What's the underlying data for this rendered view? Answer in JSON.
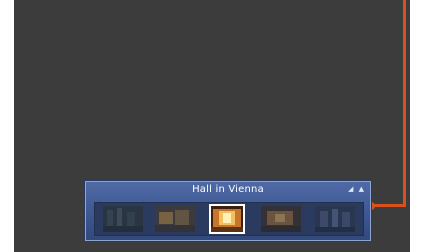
{
  "panel": {
    "title": "Hall in Vienna",
    "controls": [
      "resize-icon",
      "collapse-icon"
    ]
  },
  "thumbnails": [
    {
      "name": "dark-hall",
      "selected": false
    },
    {
      "name": "warm-hall",
      "selected": false
    },
    {
      "name": "golden-hall",
      "selected": true
    },
    {
      "name": "orange-hall",
      "selected": false
    },
    {
      "name": "blue-hall",
      "selected": false
    }
  ],
  "colors": {
    "viewport": "#3c3c3c",
    "panel": "#3c5690",
    "callout": "#d9501a"
  }
}
